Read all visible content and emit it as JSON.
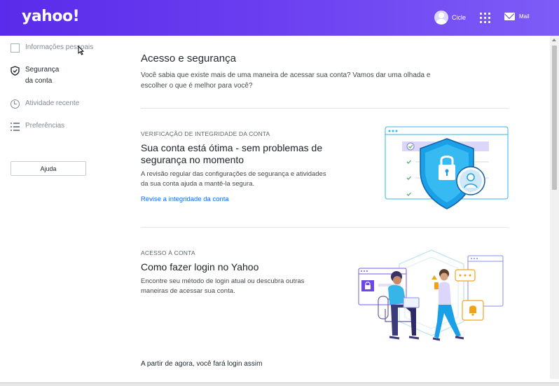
{
  "header": {
    "logo": "yahoo!",
    "user_name": "Cicle",
    "mail_label": "Mail"
  },
  "sidebar": {
    "items": [
      {
        "label": "Informações pessoais",
        "icon": "square-bullet-icon"
      },
      {
        "label": "Segurança da conta",
        "label_line1": "Segurança",
        "label_line2": "da conta",
        "icon": "shield-check-icon",
        "active": true
      },
      {
        "label": "Atividade recente",
        "icon": "clock-icon"
      },
      {
        "label": "Preferências",
        "icon": "list-icon"
      }
    ],
    "help_label": "Ajuda"
  },
  "main": {
    "title": "Acesso e segurança",
    "intro": "Você sabia que existe mais de uma maneira de acessar sua conta? Vamos dar uma olhada e escolher o que é melhor para você?",
    "sections": [
      {
        "kicker": "VERIFICAÇÃO DE INTEGRIDADE DA CONTA",
        "heading": "Sua conta está ótima - sem problemas de segurança no momento",
        "description": "A revisão regular das configurações de segurança e atividades da sua conta ajuda a mantê-la segura.",
        "link": "Revise a integridade da conta"
      },
      {
        "kicker": "ACESSO À CONTA",
        "heading": "Como fazer login no Yahoo",
        "description": "Encontre seu método de login atual ou descubra outras maneiras de acessar sua conta."
      }
    ],
    "bottom_text": "A partir de agora, você fará login assim"
  },
  "colors": {
    "header_gradient_start": "#5a2bea",
    "header_gradient_end": "#7d5cf7",
    "link": "#0f69ff",
    "shield_blue": "#1aa0e6"
  }
}
